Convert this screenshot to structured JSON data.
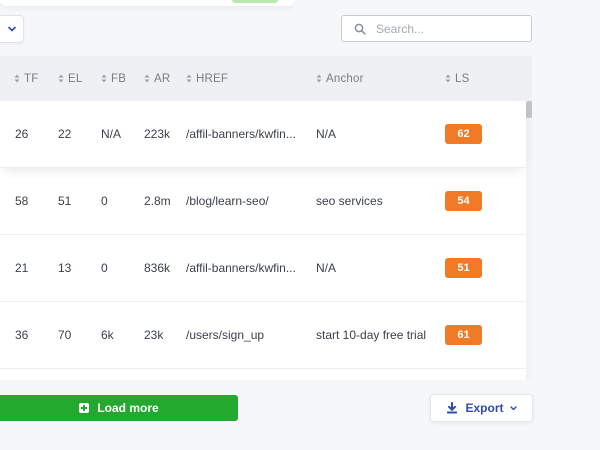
{
  "search": {
    "placeholder": "Search..."
  },
  "table": {
    "columns": [
      {
        "key": "tf",
        "label": "TF"
      },
      {
        "key": "el",
        "label": "EL"
      },
      {
        "key": "fb",
        "label": "FB"
      },
      {
        "key": "ar",
        "label": "AR"
      },
      {
        "key": "href",
        "label": "HREF"
      },
      {
        "key": "anchor",
        "label": "Anchor"
      },
      {
        "key": "ls",
        "label": "LS"
      }
    ],
    "rows": [
      {
        "tf": "26",
        "el": "22",
        "fb": "N/A",
        "ar": "223k",
        "href": "/affil-banners/kwfin...",
        "anchor": "N/A",
        "ls": "62"
      },
      {
        "tf": "58",
        "el": "51",
        "fb": "0",
        "ar": "2.8m",
        "href": "/blog/learn-seo/",
        "anchor": "seo services",
        "ls": "54"
      },
      {
        "tf": "21",
        "el": "13",
        "fb": "0",
        "ar": "836k",
        "href": "/affil-banners/kwfin...",
        "anchor": "N/A",
        "ls": "51"
      },
      {
        "tf": "36",
        "el": "70",
        "fb": "6k",
        "ar": "23k",
        "href": "/users/sign_up",
        "anchor": "start 10-day free trial",
        "ls": "61"
      }
    ]
  },
  "actions": {
    "load_more_label": "Load more",
    "export_label": "Export"
  },
  "colors": {
    "accent_green": "#22a92e",
    "badge_orange": "#f07a26",
    "export_blue": "#2f4bb0"
  },
  "icons": {
    "dropdown": "chevron-down-icon",
    "search": "search-icon",
    "sort": "sort-icon",
    "load_more": "plus-square-icon",
    "export": "download-icon"
  }
}
